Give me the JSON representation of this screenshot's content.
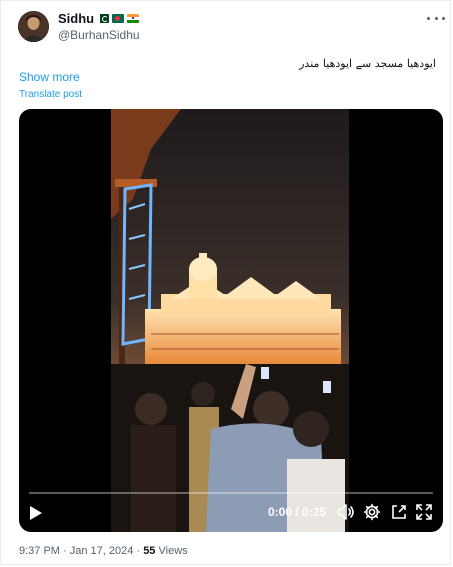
{
  "author": {
    "display_name": "Sidhu",
    "handle": "@BurhanSidhu",
    "flags": [
      "pakistan-flag",
      "bangladesh-flag",
      "india-flag"
    ]
  },
  "post": {
    "text": "ایودھیا مسجد سے ایودھیا مندر",
    "show_more": "Show more",
    "translate": "Translate post"
  },
  "video": {
    "time": "0:00 / 0:25",
    "progress": 0
  },
  "footer": {
    "time": "9:37 PM",
    "separator": "·",
    "date": "Jan 17, 2024",
    "views_count": "55",
    "views_label": "Views"
  },
  "colors": {
    "link": "#1d9bf0",
    "secondary_text": "#536471",
    "primary_text": "#0f1419"
  }
}
